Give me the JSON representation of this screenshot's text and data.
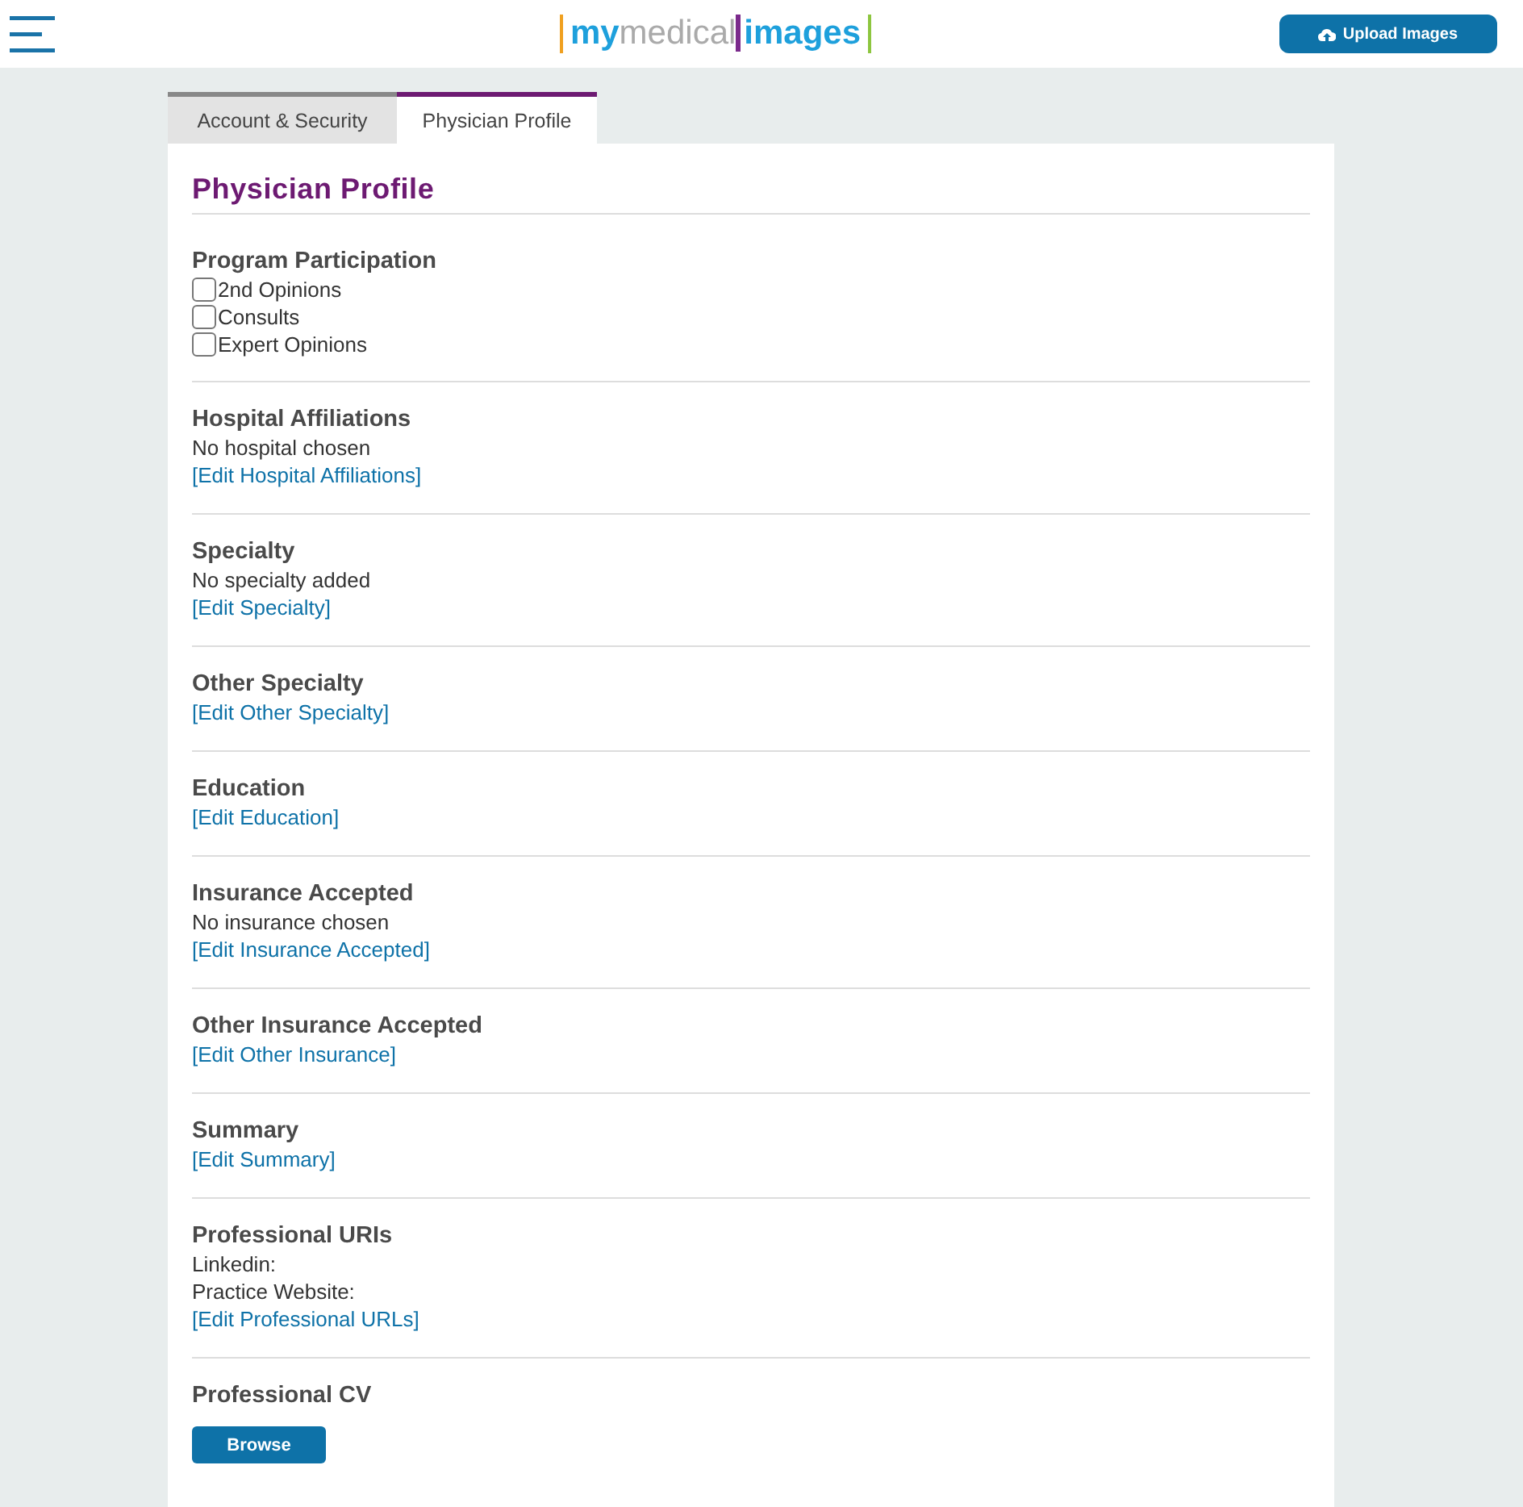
{
  "header": {
    "logo": {
      "part_1": "my",
      "part_2": "medical",
      "part_3": "images"
    },
    "upload_button": "Upload Images"
  },
  "tabs": [
    {
      "label": "Account & Security",
      "selected": false
    },
    {
      "label": "Physician Profile",
      "selected": true
    }
  ],
  "page_title": "Physician Profile",
  "sections": [
    {
      "title": "Program Participation",
      "checkboxes": [
        {
          "label": "2nd Opinions",
          "checked": false
        },
        {
          "label": "Consults",
          "checked": false
        },
        {
          "label": "Expert Opinions",
          "checked": false
        }
      ]
    },
    {
      "title": "Hospital Affiliations",
      "lines": [
        "No hospital chosen"
      ],
      "link": "[Edit Hospital Affiliations]"
    },
    {
      "title": "Specialty",
      "lines": [
        "No specialty added"
      ],
      "link": "[Edit Specialty]"
    },
    {
      "title": "Other Specialty",
      "link": "[Edit Other Specialty]"
    },
    {
      "title": "Education",
      "link": "[Edit Education]"
    },
    {
      "title": "Insurance Accepted",
      "lines": [
        "No insurance chosen"
      ],
      "link": "[Edit Insurance Accepted]"
    },
    {
      "title": "Other Insurance Accepted",
      "link": "[Edit Other Insurance]"
    },
    {
      "title": "Summary",
      "link": "[Edit Summary]"
    },
    {
      "title": "Professional URIs",
      "lines": [
        "Linkedin:",
        "Practice Website:"
      ],
      "link": "[Edit Professional URLs]"
    },
    {
      "title": "Professional CV",
      "button": "Browse"
    }
  ]
}
